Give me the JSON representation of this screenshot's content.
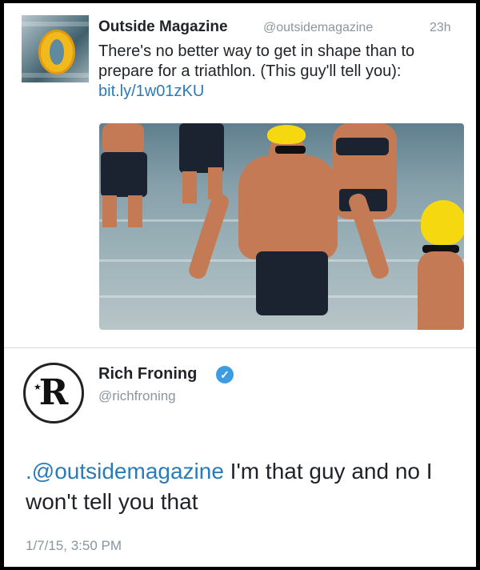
{
  "tweet1": {
    "display_name": "Outside Magazine",
    "handle": "@outsidemagazine",
    "time": "23h",
    "text": "There's no better way to get in shape than to prepare for a triathlon. (This guy'll tell you): ",
    "link": "bit.ly/1w01zKU",
    "avatar_icon": "outside-magazine-logo",
    "photo_icon": "triathlon-swimmers-photo"
  },
  "tweet2": {
    "display_name": "Rich Froning",
    "handle": "@richfroning",
    "verified": true,
    "mention": ".@outsidemagazine",
    "text": " I'm that guy and no I won't tell you that",
    "timestamp": "1/7/15, 3:50 PM",
    "avatar_icon": "rich-froning-monogram-logo"
  },
  "colors": {
    "link": "#2b7bb9",
    "secondary_text": "#8b959e",
    "verified_badge": "#3d9de0"
  }
}
